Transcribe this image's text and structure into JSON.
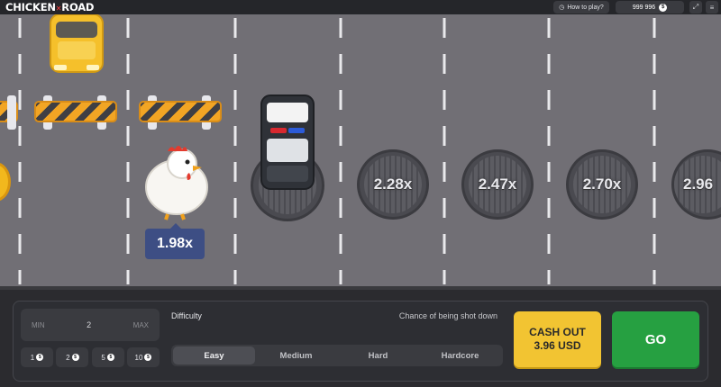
{
  "header": {
    "logo_part1": "CHICKEN",
    "logo_part2": "ROAD",
    "how_to_play": "How to play?",
    "balance": "999 996",
    "currency_icon": "dollar-coin-icon"
  },
  "game": {
    "current_multiplier": "1.98x",
    "lane_multipliers": [
      "2.28x",
      "2.47x",
      "2.70x",
      "2.96"
    ],
    "colors": {
      "road": "#716f75",
      "barrier": "#f2a524",
      "taxi": "#f5c02b",
      "badge": "#3d4e84"
    }
  },
  "controls": {
    "bet_min": "MIN",
    "bet_value": "2",
    "bet_max": "MAX",
    "chips": [
      "1",
      "2",
      "5",
      "10"
    ],
    "difficulty_label": "Difficulty",
    "chance_label": "Chance of being shot down",
    "difficulty_options": [
      "Easy",
      "Medium",
      "Hard",
      "Hardcore"
    ],
    "selected_difficulty": "Easy",
    "cashout_line1": "CASH OUT",
    "cashout_line2": "3.96 USD",
    "go_label": "GO",
    "colors": {
      "cashout": "#f2c432",
      "go": "#26a041"
    }
  }
}
